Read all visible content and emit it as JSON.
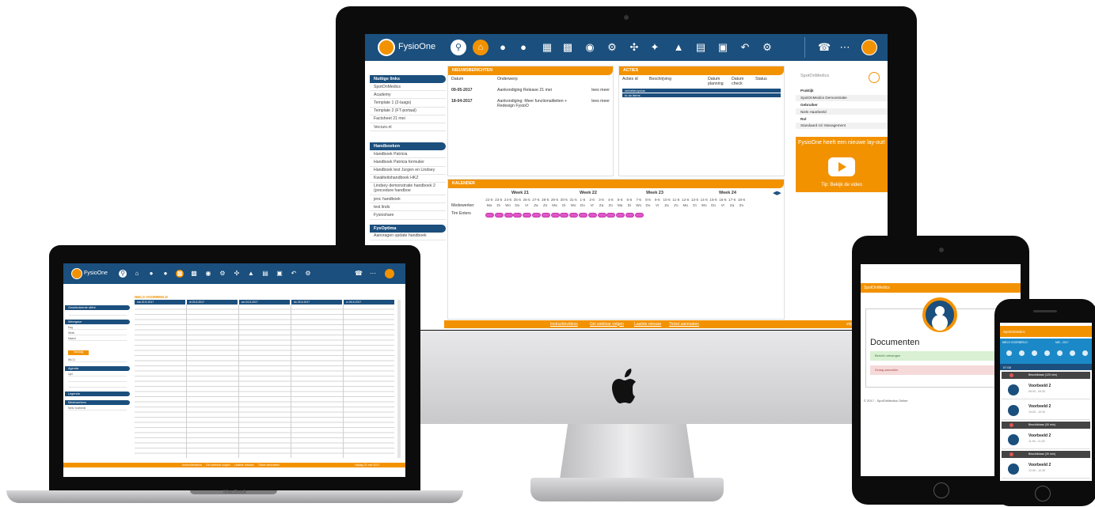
{
  "imac": {
    "app_name": "FysioOne",
    "sidebar": {
      "sections": [
        {
          "title": "Nuttige links",
          "items": [
            "SpotOnMedics",
            "Academy",
            "Template 1 (2-laags)",
            "Template 2 (FT-portaal)",
            "Factsheet 21 mei",
            "Vecozo.nl"
          ]
        },
        {
          "title": "Handboeken",
          "items": [
            "Handboek Patricia",
            "Handboek Patricia formulier",
            "Handboek test Jurgen en Lindsey",
            "Kwaliteitshandboek HKZ",
            "Lindsey demonstratie handboek 2 (procedure handboe",
            "jenc handboek",
            "test linds",
            "Fysioshare"
          ]
        },
        {
          "title": "FysOptima",
          "items": [
            "Aanvragen update handboek"
          ]
        }
      ]
    },
    "news": {
      "title": "NIEUWSBERICHTEN",
      "col_date": "Datum",
      "col_subject": "Onderwerp",
      "rows": [
        {
          "date": "09-05-2017",
          "subject": "Aankondiging Release 21 mei",
          "more": "lees meer"
        },
        {
          "date": "18-04-2017",
          "subject": "Aankondiging: Meer functionaliteiten + Redesign FysioO",
          "more": "lees meer"
        }
      ]
    },
    "actions": {
      "title": "ACTIES",
      "cols": [
        "Acties id",
        "Beschrijving",
        "Datum planning",
        "Datum check",
        "Status"
      ],
      "bars": [
        "verbetercyclus",
        "to do items"
      ]
    },
    "calendar": {
      "title": "KALENDER",
      "weeks": [
        "Week 21",
        "Week 22",
        "Week 23",
        "Week 24"
      ],
      "dates": [
        "22-5",
        "23-5",
        "24-5",
        "25-5",
        "26-5",
        "27-5",
        "28-5",
        "29-5",
        "30-5",
        "31-5",
        "1-6",
        "2-6",
        "3-6",
        "4-6",
        "5-6",
        "6-6",
        "7-6",
        "8-6",
        "9-6",
        "10-6",
        "11-6",
        "12-6",
        "13-6",
        "14-6",
        "15-6",
        "16-6",
        "17-6",
        "18-6"
      ],
      "days": [
        "Ma",
        "Di",
        "Wo",
        "Do",
        "Vr",
        "Za",
        "Zo",
        "Ma",
        "Di",
        "Wo",
        "Do",
        "Vr",
        "Za",
        "Zo",
        "Ma",
        "Di",
        "Wo",
        "Do",
        "Vr",
        "Za",
        "Zo",
        "Ma",
        "Di",
        "Wo",
        "Do",
        "Vr",
        "Za",
        "Zo"
      ],
      "row_header": "Medewerker",
      "employee": "Tim Enters",
      "dot_count": 17
    },
    "right_box": {
      "brand": "SpotOnMedics",
      "rows": [
        {
          "text": "Praktijk",
          "bold": true
        },
        {
          "text": "SpotOnMedics Demonstratie",
          "bold": false
        },
        {
          "text": "Gebruiker",
          "bold": true
        },
        {
          "text": "Niels Haarbeeld",
          "bold": false
        },
        {
          "text": "Rol",
          "bold": true
        },
        {
          "text": "Standaard rol: Management",
          "bold": false
        }
      ]
    },
    "promo": {
      "title": "FysioOne heeft een nieuwe lay-out!",
      "subtitle": "Tip: Bekijk de video"
    },
    "footer": {
      "links": [
        "Instructievideos",
        "Gin webinar volgen",
        "Laatste release",
        "Ticket aanmaken"
      ],
      "date": "vrijdag 21 mei 20"
    }
  },
  "macbook": {
    "app_name": "FysioOne",
    "brand_label": "MacBook",
    "grid_title": "NIELS VOORBEELD",
    "columns": [
      "ma 22-5-2017",
      "di 23-5-2017",
      "wo 24-5-2017",
      "do 25-5-2017",
      "vr 26-5-2017"
    ],
    "sidebar_heads": [
      "Geselecteerde cliënt",
      "Weergave",
      "Agenda",
      "Legenda",
      "Medewerkers"
    ],
    "sidebar_lines": [
      "Dag",
      "Week",
      "Maand",
      "Wk 21",
      "Lijst"
    ],
    "button": "Vandaag",
    "employee": "Niels Voorbeeld",
    "footer_links": [
      "Instructievideos",
      "Gin webinar volgen",
      "Laatste release",
      "Ticket aanmaken"
    ],
    "footer_date": "vrijdag 21 mei 2017"
  },
  "tablet": {
    "header": "SpotOnMedics",
    "title": "Documenten",
    "ok_text": "Bericht ontvangen",
    "warn_text": "Graag aanvullen",
    "footer": "© 2017 - SpotOnMedics Online"
  },
  "phone": {
    "header": "SpotOnMedics",
    "week_label": "NIELS VOORBEELD",
    "month_label": "MEI - 2017",
    "time": "07:00",
    "items": [
      {
        "kind": "bar",
        "text": "Beschikbaar (120 min)",
        "sub": "07:00 - 09:00"
      },
      {
        "kind": "appt",
        "title": "Voorbeeld 2",
        "time": "09:00 - 09:30"
      },
      {
        "kind": "appt",
        "title": "Voorbeeld 2",
        "time": "10:00 - 10:30"
      },
      {
        "kind": "bar",
        "text": "Beschikbaar (30 min)",
        "sub": "10:30 - 11:00"
      },
      {
        "kind": "appt",
        "title": "Voorbeeld 2",
        "time": "11:00 - 11:30"
      },
      {
        "kind": "bar",
        "text": "Beschikbaar (30 min)",
        "sub": "11:30 - 12:00"
      },
      {
        "kind": "appt",
        "title": "Voorbeeld 2",
        "time": "12:00 - 12:30"
      }
    ]
  },
  "colors": {
    "brand_blue": "#1b4f7d",
    "accent_orange": "#f39200",
    "calendar_pink": "#e055c8"
  }
}
